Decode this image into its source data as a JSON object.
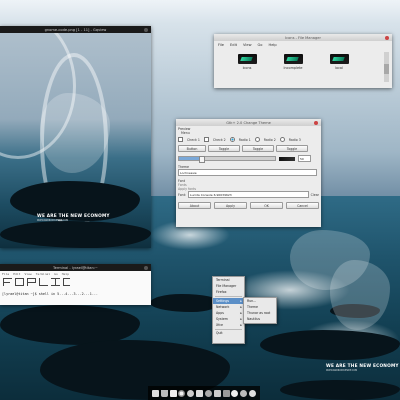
{
  "colors": {
    "accent": "#5b8fc7",
    "dark_titlebar": "#1a1a1a",
    "window_bg": "#ececec",
    "teal": "#2ed6a0"
  },
  "watermark": {
    "line1": "WE ARE THE NEW ECONOMY",
    "line2": "WWW.ANDROIDUPSIDE.COM"
  },
  "editor": {
    "title": "gnome-code.png [1 - 11] - Gqview"
  },
  "file_manager": {
    "title": "Icons - File Manager",
    "menus": [
      "File",
      "Edit",
      "View",
      "Go",
      "Help"
    ],
    "items": [
      {
        "label": "Icons"
      },
      {
        "label": "Incomplete"
      },
      {
        "label": "local"
      }
    ]
  },
  "gtk": {
    "title": "Gtk+ 2.0 Change Theme",
    "section_preview": "Preview",
    "menu_label": "Menu",
    "checks": [
      "Check 1",
      "Check 2"
    ],
    "radios": [
      "Radio 1",
      "Radio 2",
      "Radio 3"
    ],
    "buttons": [
      "Button",
      "Toggle",
      "Toggle",
      "Toggle"
    ],
    "spin_value": "50",
    "theme_label": "Theme",
    "theme_value": "Lochnessie",
    "font_label": "Font",
    "font_name_label": "Fonts",
    "apply_font_label": "Apply fonts",
    "font_field_label": "Font:",
    "font_value": "Lucida Console 6.90039623",
    "clear_label": "Clear",
    "about": "About",
    "apply": "Apply",
    "ok": "OK",
    "cancel": "Cancel"
  },
  "terminal": {
    "title": "Terminal - lyrael@titan:~",
    "menus": [
      "File",
      "Edit",
      "View",
      "Terminal",
      "Go",
      "Help"
    ],
    "prompt": "[lyrael@titan ~]$",
    "command": "shell in 5...4...3...2...1..."
  },
  "menu": {
    "items": [
      {
        "label": "Terminal",
        "arrow": ""
      },
      {
        "label": "File Manager",
        "arrow": ""
      },
      {
        "label": "Firefox",
        "arrow": ""
      },
      {
        "label": "Settings",
        "arrow": "▸",
        "highlight": true
      },
      {
        "label": "Network",
        "arrow": "▸"
      },
      {
        "label": "Apps",
        "arrow": "▸"
      },
      {
        "label": "System",
        "arrow": "▸"
      },
      {
        "label": "Xfce",
        "arrow": "▸"
      },
      {
        "label": "Quit",
        "arrow": ""
      }
    ],
    "submenu": [
      "Run...",
      "Theme",
      "Thunar as root",
      "Nautilus"
    ]
  },
  "dock": {
    "icons": [
      "terminal-icon",
      "trash-icon",
      "home-icon",
      "firefox-icon",
      "chat-icon",
      "editor-icon",
      "music-icon",
      "photo-icon",
      "settings-icon",
      "user-icon",
      "gear-icon",
      "quit-icon"
    ]
  }
}
